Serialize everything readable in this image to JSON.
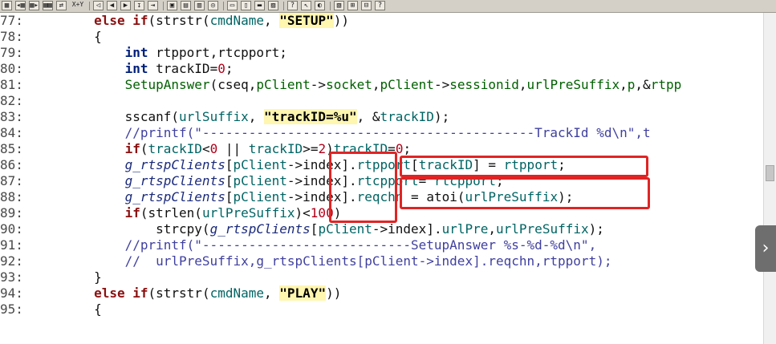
{
  "toolbar": {
    "icons": [
      "find-icon",
      "find-previous-icon",
      "find-next-icon",
      "find-in-files-icon",
      "replace-icon",
      "x-y-icon",
      "bookmark-back-icon",
      "navigate-back-icon",
      "navigate-forward-icon",
      "jump-icon",
      "jump-end-icon",
      "symbol-window-icon",
      "relation-window-icon",
      "context-window-icon",
      "code-check-icon",
      "layout-single-icon",
      "layout-split-icon",
      "layout-stack-icon",
      "layout-restore-icon",
      "symbol-info-icon",
      "help-pointer-icon",
      "browse-icon",
      "overview-icon",
      "tree-icon",
      "hierarchy-icon",
      "help-icon"
    ],
    "x_y_label": "X+Y"
  },
  "editor": {
    "lines": [
      {
        "num": "77:",
        "tokens": [
          {
            "t": "        ",
            "c": "df"
          },
          {
            "t": "else if",
            "c": "kw"
          },
          {
            "t": "(",
            "c": "df"
          },
          {
            "t": "strstr",
            "c": "df"
          },
          {
            "t": "(",
            "c": "df"
          },
          {
            "t": "cmdName",
            "c": "va"
          },
          {
            "t": ", ",
            "c": "df"
          },
          {
            "t": "\"SETUP\"",
            "c": "st"
          },
          {
            "t": "))",
            "c": "df"
          }
        ]
      },
      {
        "num": "78:",
        "tokens": [
          {
            "t": "        {",
            "c": "df"
          }
        ]
      },
      {
        "num": "79:",
        "tokens": [
          {
            "t": "            ",
            "c": "df"
          },
          {
            "t": "int",
            "c": "tp"
          },
          {
            "t": " rtpport,rtcpport;",
            "c": "df"
          }
        ]
      },
      {
        "num": "80:",
        "tokens": [
          {
            "t": "            ",
            "c": "df"
          },
          {
            "t": "int",
            "c": "tp"
          },
          {
            "t": " trackID=",
            "c": "df"
          },
          {
            "t": "0",
            "c": "nm"
          },
          {
            "t": ";",
            "c": "df"
          }
        ]
      },
      {
        "num": "81:",
        "tokens": [
          {
            "t": "            ",
            "c": "df"
          },
          {
            "t": "SetupAnswer",
            "c": "fn"
          },
          {
            "t": "(cseq,",
            "c": "df"
          },
          {
            "t": "pClient",
            "c": "fn"
          },
          {
            "t": "->",
            "c": "df"
          },
          {
            "t": "socket",
            "c": "fn"
          },
          {
            "t": ",",
            "c": "df"
          },
          {
            "t": "pClient",
            "c": "fn"
          },
          {
            "t": "->",
            "c": "df"
          },
          {
            "t": "sessionid",
            "c": "fn"
          },
          {
            "t": ",",
            "c": "df"
          },
          {
            "t": "urlPreSuffix",
            "c": "fn"
          },
          {
            "t": ",",
            "c": "df"
          },
          {
            "t": "p",
            "c": "fn"
          },
          {
            "t": ",&",
            "c": "df"
          },
          {
            "t": "rtpp",
            "c": "fn"
          }
        ]
      },
      {
        "num": "82:",
        "tokens": []
      },
      {
        "num": "83:",
        "tokens": [
          {
            "t": "            ",
            "c": "df"
          },
          {
            "t": "sscanf",
            "c": "df"
          },
          {
            "t": "(",
            "c": "df"
          },
          {
            "t": "urlSuffix",
            "c": "va"
          },
          {
            "t": ", ",
            "c": "df"
          },
          {
            "t": "\"trackID=%u\"",
            "c": "st"
          },
          {
            "t": ", &",
            "c": "df"
          },
          {
            "t": "trackID",
            "c": "va"
          },
          {
            "t": ");",
            "c": "df"
          }
        ]
      },
      {
        "num": "84:",
        "tokens": [
          {
            "t": "            ",
            "c": "df"
          },
          {
            "t": "//printf(\"-------------------------------------------TrackId %d\\n\",t",
            "c": "cm"
          }
        ]
      },
      {
        "num": "85:",
        "tokens": [
          {
            "t": "            ",
            "c": "df"
          },
          {
            "t": "if",
            "c": "kw"
          },
          {
            "t": "(",
            "c": "df"
          },
          {
            "t": "trackID",
            "c": "va"
          },
          {
            "t": "<",
            "c": "df"
          },
          {
            "t": "0",
            "c": "nm"
          },
          {
            "t": " || ",
            "c": "df"
          },
          {
            "t": "trackID",
            "c": "va"
          },
          {
            "t": ">=",
            "c": "df"
          },
          {
            "t": "2",
            "c": "nm"
          },
          {
            "t": ")",
            "c": "df"
          },
          {
            "t": "trackID",
            "c": "va"
          },
          {
            "t": "=",
            "c": "df"
          },
          {
            "t": "0",
            "c": "nm"
          },
          {
            "t": ";",
            "c": "df"
          }
        ]
      },
      {
        "num": "86:",
        "tokens": [
          {
            "t": "            ",
            "c": "df"
          },
          {
            "t": "g_rtspClients",
            "c": "gv"
          },
          {
            "t": "[",
            "c": "df"
          },
          {
            "t": "pClient",
            "c": "va"
          },
          {
            "t": "->",
            "c": "df"
          },
          {
            "t": "index",
            "c": "df"
          },
          {
            "t": "].",
            "c": "df"
          },
          {
            "t": "rtpport",
            "c": "va"
          },
          {
            "t": "[",
            "c": "df"
          },
          {
            "t": "trackID",
            "c": "va"
          },
          {
            "t": "] = ",
            "c": "df"
          },
          {
            "t": "rtpport",
            "c": "va"
          },
          {
            "t": ";",
            "c": "df"
          }
        ]
      },
      {
        "num": "87:",
        "tokens": [
          {
            "t": "            ",
            "c": "df"
          },
          {
            "t": "g_rtspClients",
            "c": "gv"
          },
          {
            "t": "[",
            "c": "df"
          },
          {
            "t": "pClient",
            "c": "va"
          },
          {
            "t": "->",
            "c": "df"
          },
          {
            "t": "index",
            "c": "df"
          },
          {
            "t": "].",
            "c": "df"
          },
          {
            "t": "rtcpport",
            "c": "va"
          },
          {
            "t": "= ",
            "c": "df"
          },
          {
            "t": "rtcpport",
            "c": "va"
          },
          {
            "t": ";",
            "c": "df"
          }
        ]
      },
      {
        "num": "88:",
        "tokens": [
          {
            "t": "            ",
            "c": "df"
          },
          {
            "t": "g_rtspClients",
            "c": "gv"
          },
          {
            "t": "[",
            "c": "df"
          },
          {
            "t": "pClient",
            "c": "va"
          },
          {
            "t": "->",
            "c": "df"
          },
          {
            "t": "index",
            "c": "df"
          },
          {
            "t": "].",
            "c": "df"
          },
          {
            "t": "reqchn",
            "c": "va"
          },
          {
            "t": " = ",
            "c": "df"
          },
          {
            "t": "atoi",
            "c": "df"
          },
          {
            "t": "(",
            "c": "df"
          },
          {
            "t": "urlPreSuffix",
            "c": "va"
          },
          {
            "t": ");",
            "c": "df"
          }
        ]
      },
      {
        "num": "89:",
        "tokens": [
          {
            "t": "            ",
            "c": "df"
          },
          {
            "t": "if",
            "c": "kw"
          },
          {
            "t": "(",
            "c": "df"
          },
          {
            "t": "strlen",
            "c": "df"
          },
          {
            "t": "(",
            "c": "df"
          },
          {
            "t": "urlPreSuffix",
            "c": "va"
          },
          {
            "t": ")<",
            "c": "df"
          },
          {
            "t": "100",
            "c": "nm"
          },
          {
            "t": ")",
            "c": "df"
          }
        ]
      },
      {
        "num": "90:",
        "tokens": [
          {
            "t": "                ",
            "c": "df"
          },
          {
            "t": "strcpy",
            "c": "df"
          },
          {
            "t": "(",
            "c": "df"
          },
          {
            "t": "g_rtspClients",
            "c": "gv"
          },
          {
            "t": "[",
            "c": "df"
          },
          {
            "t": "pClient",
            "c": "va"
          },
          {
            "t": "->",
            "c": "df"
          },
          {
            "t": "index",
            "c": "df"
          },
          {
            "t": "].",
            "c": "df"
          },
          {
            "t": "urlPre",
            "c": "va"
          },
          {
            "t": ",",
            "c": "df"
          },
          {
            "t": "urlPreSuffix",
            "c": "va"
          },
          {
            "t": ");",
            "c": "df"
          }
        ]
      },
      {
        "num": "91:",
        "tokens": [
          {
            "t": "            ",
            "c": "df"
          },
          {
            "t": "//printf(\"---------------------------SetupAnswer %s-%d-%d\\n\",",
            "c": "cm"
          }
        ]
      },
      {
        "num": "92:",
        "tokens": [
          {
            "t": "            ",
            "c": "df"
          },
          {
            "t": "//  urlPreSuffix,g_rtspClients[pClient->index].reqchn,rtpport);",
            "c": "cm"
          }
        ]
      },
      {
        "num": "93:",
        "tokens": [
          {
            "t": "        }",
            "c": "df"
          }
        ]
      },
      {
        "num": "94:",
        "tokens": [
          {
            "t": "        ",
            "c": "df"
          },
          {
            "t": "else if",
            "c": "kw"
          },
          {
            "t": "(",
            "c": "df"
          },
          {
            "t": "strstr",
            "c": "df"
          },
          {
            "t": "(",
            "c": "df"
          },
          {
            "t": "cmdName",
            "c": "va"
          },
          {
            "t": ", ",
            "c": "df"
          },
          {
            "t": "\"PLAY\"",
            "c": "st"
          },
          {
            "t": "))",
            "c": "df"
          }
        ]
      },
      {
        "num": "95:",
        "tokens": [
          {
            "t": "        {",
            "c": "df"
          }
        ]
      }
    ],
    "highlight_color": "#e02424"
  },
  "overlay": {
    "next_arrow": "›"
  }
}
